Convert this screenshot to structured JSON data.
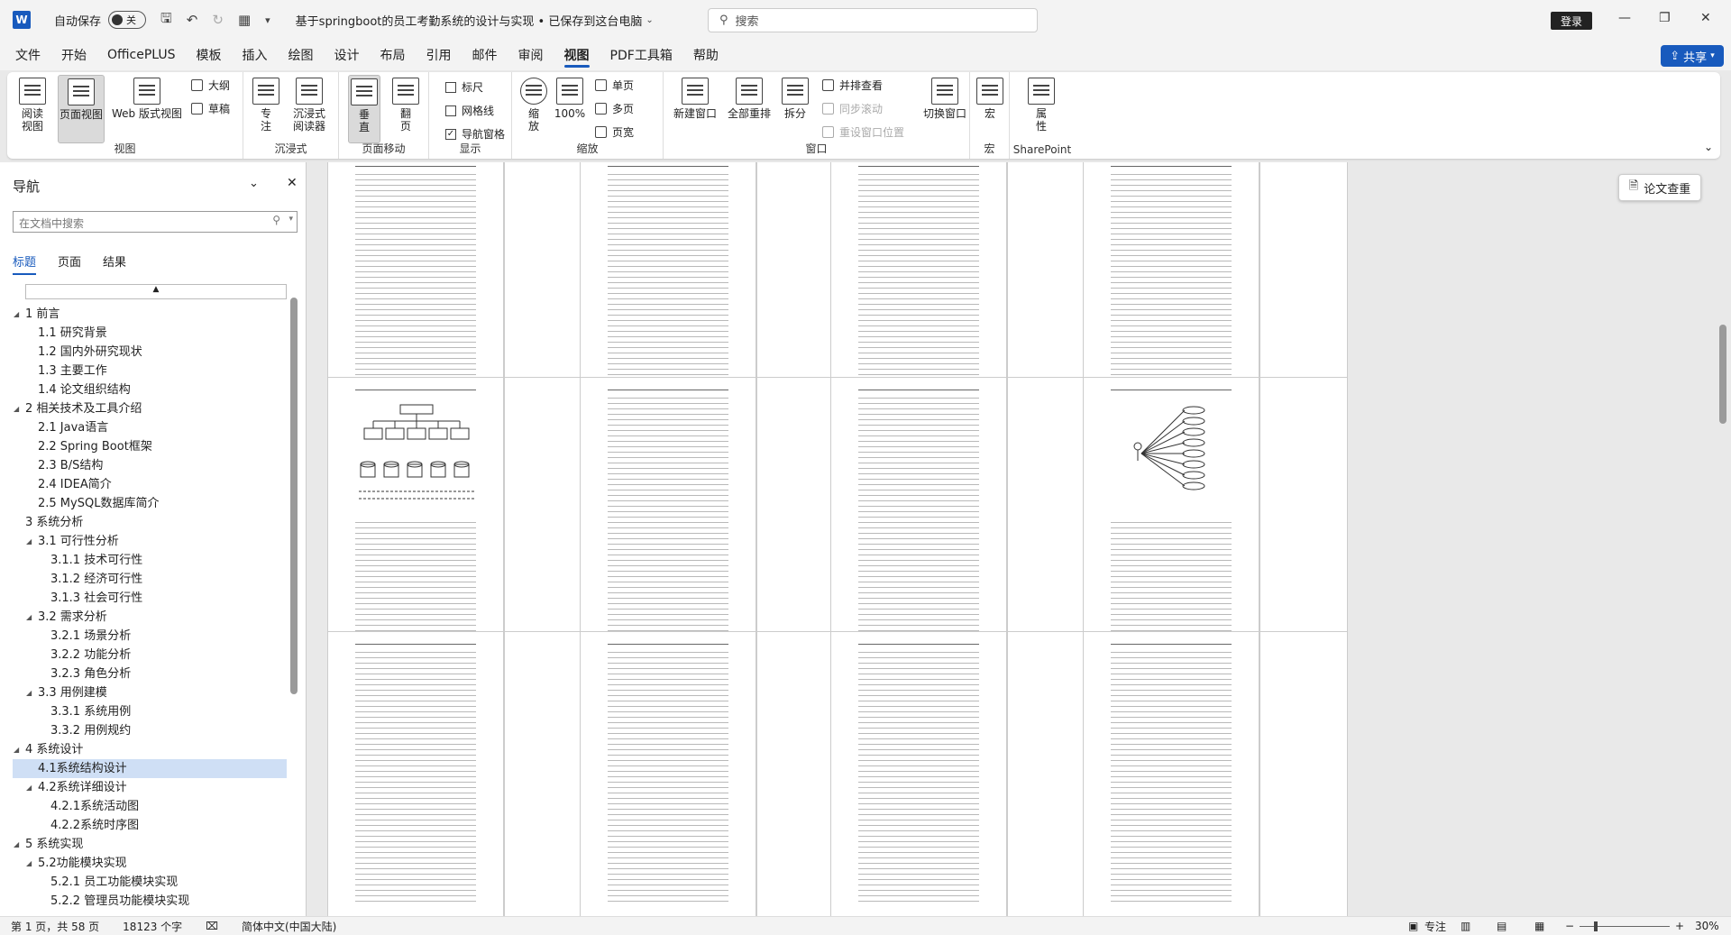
{
  "titlebar": {
    "app_icon": "word-icon",
    "app_letter": "W",
    "autosave_label": "自动保存",
    "autosave_state": "关",
    "doc_title": "基于springboot的员工考勤系统的设计与实现 • 已保存到这台电脑",
    "search_placeholder": "搜索",
    "login_label": "登录"
  },
  "menu": {
    "tabs": [
      "文件",
      "开始",
      "OfficePLUS",
      "模板",
      "插入",
      "绘图",
      "设计",
      "布局",
      "引用",
      "邮件",
      "审阅",
      "视图",
      "PDF工具箱",
      "帮助"
    ],
    "active_tab": "视图",
    "share_label": "共享"
  },
  "ribbon": {
    "views": {
      "label": "视图",
      "read": "阅读\n视图",
      "print": "页面视图",
      "web": "Web 版式视图",
      "outline": "大纲",
      "draft": "草稿"
    },
    "immersive": {
      "label": "沉浸式",
      "focus": "专\n注",
      "reader": "沉浸式\n阅读器"
    },
    "pagemove": {
      "label": "页面移动",
      "vertical": "垂\n直",
      "side": "翻\n页"
    },
    "show": {
      "label": "显示",
      "ruler": "标尺",
      "gridlines": "网格线",
      "navpane": "导航窗格",
      "ruler_checked": false,
      "gridlines_checked": false,
      "navpane_checked": true
    },
    "zoom": {
      "label": "缩放",
      "zoom": "缩\n放",
      "pct": "100%",
      "one_page": "单页",
      "multi_page": "多页",
      "page_width": "页宽"
    },
    "window": {
      "label": "窗口",
      "new": "新建窗口",
      "arrange": "全部重排",
      "split": "拆分",
      "side_by_side": "并排查看",
      "sync_scroll": "同步滚动",
      "reset_pos": "重设窗口位置",
      "switch": "切换窗口"
    },
    "macro": {
      "label": "宏",
      "macro": "宏"
    },
    "sharepoint": {
      "label": "SharePoint",
      "props": "属\n性"
    }
  },
  "nav": {
    "title": "导航",
    "search_placeholder": "在文档中搜索",
    "tabs": [
      "标题",
      "页面",
      "结果"
    ],
    "active_tab": "标题",
    "items": [
      {
        "label": "1 前言",
        "level": 1,
        "expanded": true
      },
      {
        "label": "1.1 研究背景",
        "level": 2
      },
      {
        "label": "1.2 国内外研究现状",
        "level": 2
      },
      {
        "label": "1.3 主要工作",
        "level": 2
      },
      {
        "label": "1.4 论文组织结构",
        "level": 2
      },
      {
        "label": "2 相关技术及工具介绍",
        "level": 1,
        "expanded": true
      },
      {
        "label": "2.1 Java语言",
        "level": 2
      },
      {
        "label": "2.2 Spring Boot框架",
        "level": 2
      },
      {
        "label": "2.3 B/S结构",
        "level": 2
      },
      {
        "label": "2.4 IDEA简介",
        "level": 2
      },
      {
        "label": "2.5 MySQL数据库简介",
        "level": 2
      },
      {
        "label": "3   系统分析",
        "level": 1
      },
      {
        "label": "3.1 可行性分析",
        "level": 2,
        "expanded": true
      },
      {
        "label": "3.1.1 技术可行性",
        "level": 3
      },
      {
        "label": "3.1.2 经济可行性",
        "level": 3
      },
      {
        "label": "3.1.3 社会可行性",
        "level": 3
      },
      {
        "label": "3.2 需求分析",
        "level": 2,
        "expanded": true
      },
      {
        "label": "3.2.1 场景分析",
        "level": 3
      },
      {
        "label": "3.2.2 功能分析",
        "level": 3
      },
      {
        "label": "3.2.3 角色分析",
        "level": 3
      },
      {
        "label": "3.3 用例建模",
        "level": 2,
        "expanded": true
      },
      {
        "label": "3.3.1 系统用例",
        "level": 3
      },
      {
        "label": "3.3.2 用例规约",
        "level": 3
      },
      {
        "label": "4 系统设计",
        "level": 1,
        "expanded": true
      },
      {
        "label": "4.1系统结构设计",
        "level": 2,
        "selected": true
      },
      {
        "label": "4.2系统详细设计",
        "level": 2,
        "expanded": true
      },
      {
        "label": "4.2.1系统活动图",
        "level": 3
      },
      {
        "label": "4.2.2系统时序图",
        "level": 3
      },
      {
        "label": "5 系统实现",
        "level": 1,
        "expanded": true
      },
      {
        "label": "5.2功能模块实现",
        "level": 2,
        "expanded": true
      },
      {
        "label": "5.2.1 员工功能模块实现",
        "level": 3
      },
      {
        "label": "5.2.2 管理员功能模块实现",
        "level": 3
      }
    ]
  },
  "paper_check": "论文查重",
  "status": {
    "page": "第 1 页，共 58 页",
    "words": "18123 个字",
    "language": "简体中文(中国大陆)",
    "focus": "专注",
    "zoom": "30%"
  },
  "colors": {
    "accent": "#185abd",
    "selected_nav": "#cfdff5"
  }
}
